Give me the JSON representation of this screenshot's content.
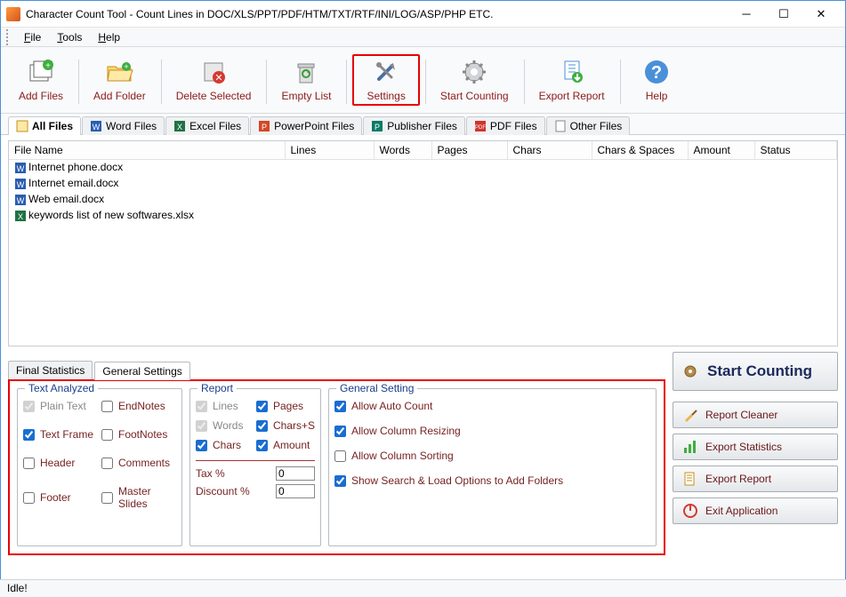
{
  "titlebar": {
    "title": "Character Count Tool - Count Lines in DOC/XLS/PPT/PDF/HTM/TXT/RTF/INI/LOG/ASP/PHP ETC."
  },
  "menubar": {
    "file": "File",
    "tools": "Tools",
    "help": "Help"
  },
  "toolbar": {
    "add_files": "Add Files",
    "add_folder": "Add Folder",
    "delete_selected": "Delete Selected",
    "empty_list": "Empty List",
    "settings": "Settings",
    "start_counting": "Start Counting",
    "export_report": "Export Report",
    "help": "Help"
  },
  "filetabs": {
    "all": "All Files",
    "word": "Word Files",
    "excel": "Excel Files",
    "ppt": "PowerPoint Files",
    "pub": "Publisher Files",
    "pdf": "PDF Files",
    "other": "Other Files"
  },
  "table": {
    "headers": [
      "File Name",
      "Lines",
      "Words",
      "Pages",
      "Chars",
      "Chars & Spaces",
      "Amount",
      "Status"
    ],
    "rows": [
      {
        "name": "Internet phone.docx",
        "type": "word"
      },
      {
        "name": "Internet email.docx",
        "type": "word"
      },
      {
        "name": "Web email.docx",
        "type": "word"
      },
      {
        "name": "keywords list of new softwares.xlsx",
        "type": "excel"
      }
    ]
  },
  "bottom_tabs": {
    "final_stats": "Final Statistics",
    "general_settings": "General Settings"
  },
  "settings": {
    "text_analyzed": {
      "legend": "Text Analyzed",
      "plain_text": "Plain Text",
      "endnotes": "EndNotes",
      "text_frame": "Text Frame",
      "footnotes": "FootNotes",
      "header": "Header",
      "comments": "Comments",
      "footer": "Footer",
      "master_slides": "Master\nSlides"
    },
    "report": {
      "legend": "Report",
      "lines": "Lines",
      "pages": "Pages",
      "words": "Words",
      "chars_s": "Chars+S",
      "chars": "Chars",
      "amount": "Amount",
      "tax": "Tax %",
      "discount": "Discount %",
      "tax_val": "0",
      "discount_val": "0"
    },
    "general": {
      "legend": "General Setting",
      "auto_count": "Allow Auto Count",
      "col_resize": "Allow Column Resizing",
      "col_sort": "Allow Column Sorting",
      "show_search": "Show Search & Load Options to Add Folders"
    }
  },
  "side": {
    "start": "Start Counting",
    "cleaner": "Report Cleaner",
    "stats": "Export Statistics",
    "export": "Export Report",
    "exit": "Exit Application"
  },
  "status": "Idle!"
}
